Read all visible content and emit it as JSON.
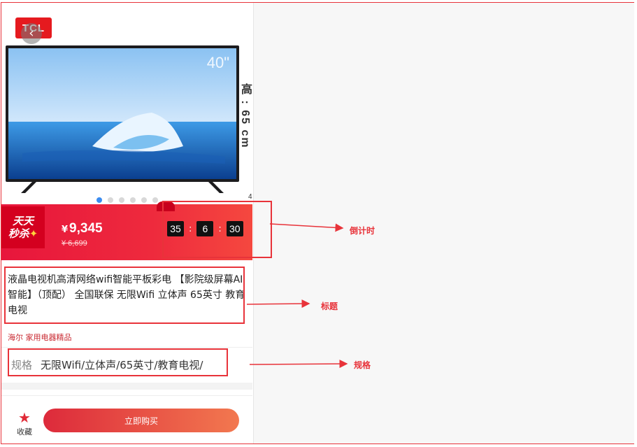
{
  "product": {
    "brand_logo_text": "TCL",
    "tv_size_label": "40\"",
    "dimension_text": "高 : 65 cm",
    "dimension_partial": "4",
    "carousel": {
      "count": 6,
      "active_index": 0
    }
  },
  "flash_sale": {
    "badge_line1": "天天",
    "badge_line2": "秒杀",
    "price_symbol": "¥",
    "price": "9,345",
    "original_price": "¥ 6,699",
    "countdown": {
      "hours": "35",
      "minutes": "6",
      "seconds": "30",
      "separator": ":"
    }
  },
  "title": "液晶电视机高清网络wifi智能平板彩电 【影院级屏幕AI智能】（顶配） 全国联保 无限Wifi 立体声 65英寸 教育电视",
  "brand_tag": "海尔 家用电器精品",
  "spec": {
    "label": "规格",
    "value": "无限Wifi/立体声/65英寸/教育电视/"
  },
  "bottom_bar": {
    "favorite_label": "收藏",
    "buy_label": "立即购买"
  },
  "annotations": {
    "countdown": "倒计时",
    "title": "标题",
    "spec": "规格"
  },
  "colors": {
    "accent_red": "#e8333a",
    "flash_red": "#ee2a3d",
    "brand_red": "#c8272f",
    "carousel_active": "#3b8cf0"
  }
}
